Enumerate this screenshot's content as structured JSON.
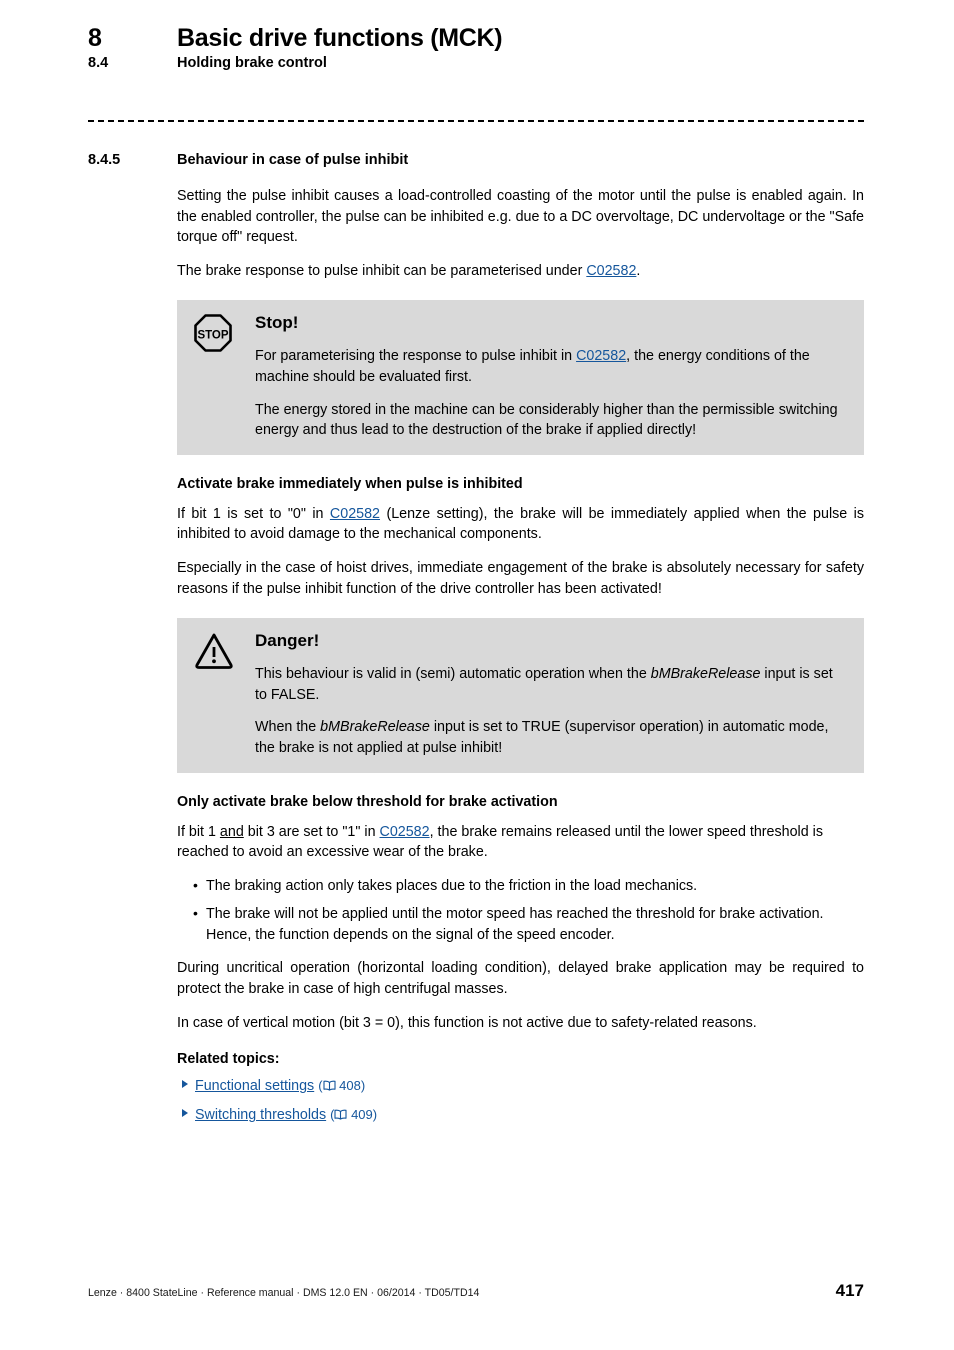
{
  "header": {
    "chapter_number": "8",
    "chapter_title": "Basic drive functions (MCK)",
    "section_number": "8.4",
    "section_title": "Holding brake control"
  },
  "section": {
    "number": "8.4.5",
    "title": "Behaviour in case of pulse inhibit"
  },
  "intro": {
    "paragraph1": "Setting the pulse inhibit causes a load-controlled coasting of the motor until the pulse is enabled again. In the enabled controller, the pulse can be inhibited e.g. due to a DC overvoltage, DC undervoltage or the \"Safe torque off\" request.",
    "paragraph2_before": "The brake response to pulse inhibit can be parameterised under ",
    "paragraph2_link": "C02582",
    "paragraph2_after": "."
  },
  "stop_callout": {
    "icon": "stop-octagon-icon",
    "icon_text": "STOP",
    "title": "Stop!",
    "paragraph1_before": "For parameterising the response to pulse inhibit in ",
    "paragraph1_link": "C02582",
    "paragraph1_after": ", the energy conditions of the machine should be evaluated first.",
    "paragraph2": "The energy stored in the machine can be considerably higher than the permissible switching energy and thus lead to the destruction of the brake if applied directly!"
  },
  "activate_section": {
    "heading": "Activate brake immediately when pulse is inhibited",
    "paragraph1_before": "If bit 1 is set to \"0\" in ",
    "paragraph1_link": "C02582",
    "paragraph1_after": " (Lenze setting), the brake will be immediately applied when the pulse is inhibited to avoid damage to the mechanical components.",
    "paragraph2": "Especially in the case of hoist drives, immediate engagement of the brake is absolutely necessary for safety reasons if the pulse inhibit function of the drive controller has been activated!"
  },
  "danger_callout": {
    "icon": "warning-triangle-icon",
    "title": "Danger!",
    "paragraph1_before": "This behaviour is valid in (semi) automatic operation when the ",
    "paragraph1_italic": "bMBrakeRelease",
    "paragraph1_after": " input is set to FALSE.",
    "paragraph2_before": "When the ",
    "paragraph2_italic": "bMBrakeRelease",
    "paragraph2_after": " input is set to TRUE (supervisor operation) in automatic mode, the brake is not applied at pulse inhibit!"
  },
  "threshold_section": {
    "heading": "Only activate brake below threshold for brake activation",
    "paragraph1_part1": "If bit 1 ",
    "paragraph1_underlined": "and",
    "paragraph1_part2": " bit 3 are set to \"1\" in ",
    "paragraph1_link": "C02582",
    "paragraph1_part3": ", the brake remains released until the lower speed threshold is reached to avoid an excessive wear of the brake.",
    "bullets": [
      "The braking action only takes places due to the friction in the load mechanics.",
      "The brake will not be applied until the motor speed has reached the threshold for brake activation. Hence, the function depends on the signal of the speed encoder."
    ],
    "paragraph2": "During uncritical operation (horizontal loading condition), delayed brake application may be required to protect the brake in case of high centrifugal masses.",
    "paragraph3": "In case of vertical motion (bit 3 = 0), this function is not active due to safety-related reasons."
  },
  "related_topics": {
    "heading": "Related topics:",
    "items": [
      {
        "label": "Functional settings",
        "ref_open": "(",
        "book_icon": "book-icon",
        "page": "408",
        "ref_close": ")"
      },
      {
        "label": "Switching thresholds",
        "ref_open": "(",
        "book_icon": "book-icon",
        "page": "409",
        "ref_close": ")"
      }
    ]
  },
  "footer": {
    "text": "Lenze · 8400 StateLine · Reference manual · DMS 12.0 EN · 06/2014 · TD05/TD14",
    "page_number": "417"
  },
  "colors": {
    "link": "#15569c",
    "callout_background": "#d9d9d9"
  }
}
